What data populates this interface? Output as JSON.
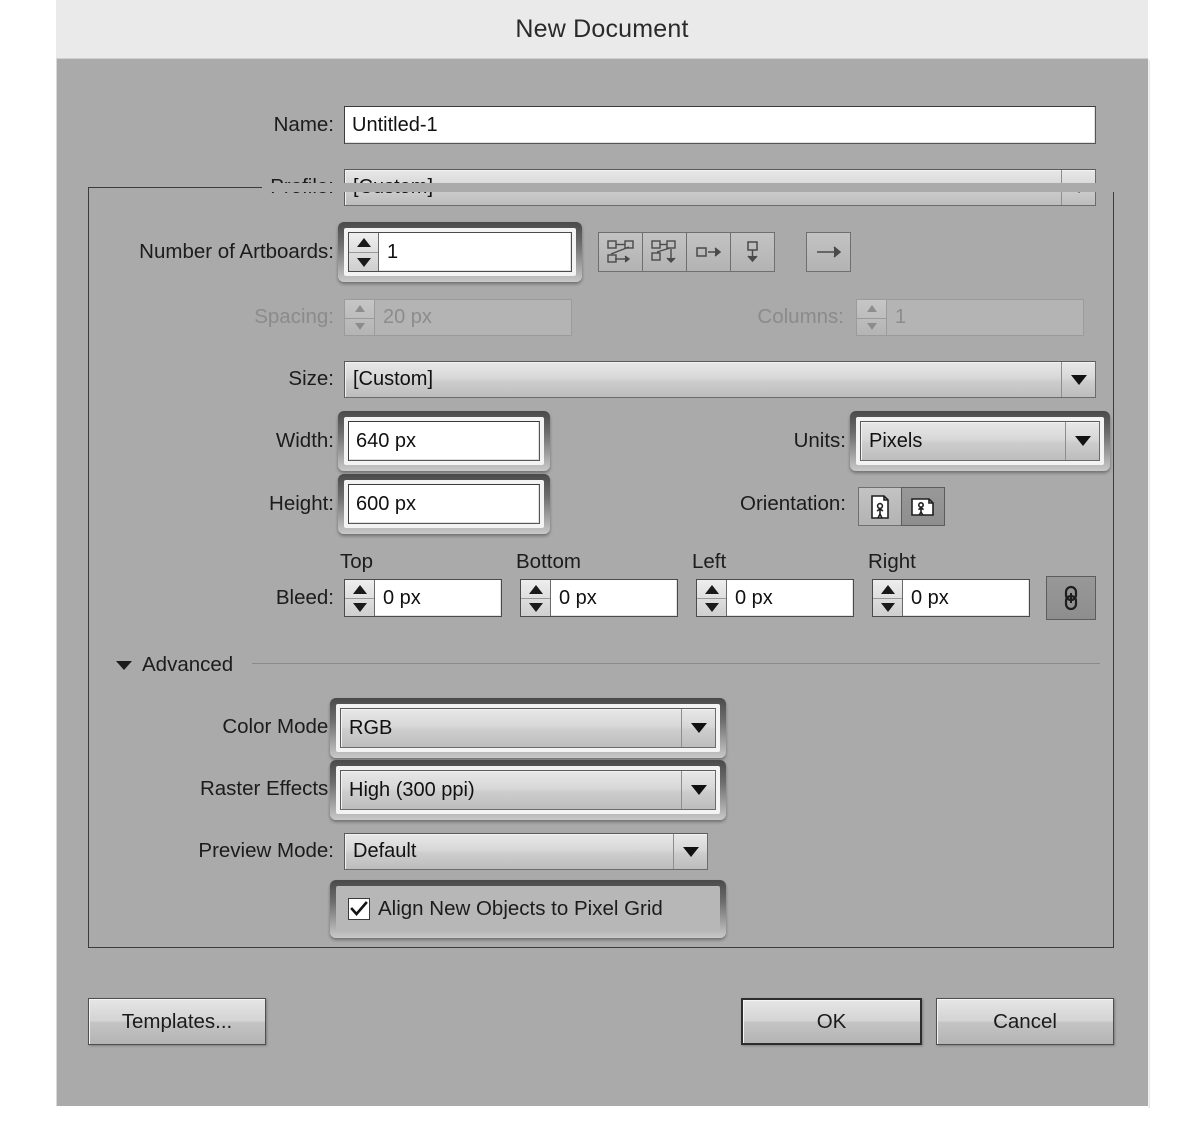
{
  "window": {
    "title": "New Document"
  },
  "fields": {
    "name": {
      "label": "Name:",
      "value": "Untitled-1"
    },
    "profile": {
      "label": "Profile:",
      "value": "[Custom]"
    },
    "artboards": {
      "label": "Number of Artboards:",
      "value": "1"
    },
    "spacing": {
      "label": "Spacing:",
      "value": "20 px"
    },
    "columns": {
      "label": "Columns:",
      "value": "1"
    },
    "size": {
      "label": "Size:",
      "value": "[Custom]"
    },
    "width": {
      "label": "Width:",
      "value": "640 px"
    },
    "height": {
      "label": "Height:",
      "value": "600 px"
    },
    "units": {
      "label": "Units:",
      "value": "Pixels"
    },
    "orientation": {
      "label": "Orientation:"
    },
    "bleed": {
      "label": "Bleed:"
    },
    "color_mode": {
      "label": "Color Mode:",
      "value": "RGB"
    },
    "raster_effects": {
      "label": "Raster Effects:",
      "value": "High (300 ppi)"
    },
    "preview_mode": {
      "label": "Preview Mode:",
      "value": "Default"
    },
    "align_pixel_grid": {
      "label": "Align New Objects to Pixel Grid",
      "checked": true
    }
  },
  "bleed_fields": [
    {
      "header": "Top",
      "value": "0 px"
    },
    {
      "header": "Bottom",
      "value": "0 px"
    },
    {
      "header": "Left",
      "value": "0 px"
    },
    {
      "header": "Right",
      "value": "0 px"
    }
  ],
  "artboard_layout_icons": [
    {
      "name": "grid-by-row-icon"
    },
    {
      "name": "grid-by-column-icon"
    },
    {
      "name": "arrange-by-row-icon"
    },
    {
      "name": "arrange-by-column-icon"
    }
  ],
  "artboard_flow_icon": {
    "name": "change-to-right-to-left-layout-icon"
  },
  "orientation_options": [
    {
      "name": "portrait-icon",
      "selected": false
    },
    {
      "name": "landscape-icon",
      "selected": true
    }
  ],
  "bleed_link": {
    "name": "link-bleeds-icon"
  },
  "advanced": {
    "label": "Advanced",
    "expanded": true
  },
  "buttons": {
    "templates": "Templates...",
    "ok": "OK",
    "cancel": "Cancel"
  },
  "colors": {
    "dialog_bg": "#aaaaaa",
    "titlebar_bg": "#eaeaea",
    "page_bg": "#ffffff",
    "text": "#1c1c1c",
    "disabled_text": "#8b8b8b",
    "field_bg": "#ffffff",
    "focus_ring": "#4a4a4a"
  }
}
